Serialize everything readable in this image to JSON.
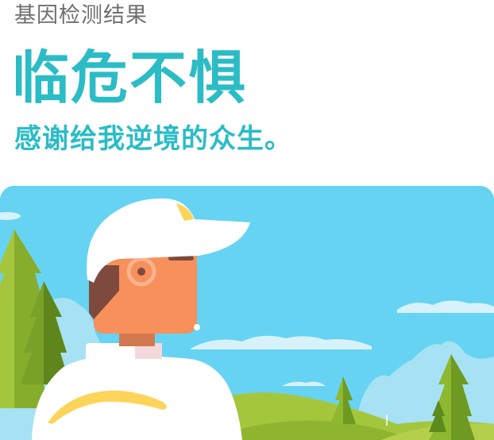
{
  "header": {
    "kicker": "基因检测结果",
    "headline": "临危不惧",
    "subline": "感谢给我逆境的众生。"
  },
  "illustration": {
    "description_icon": "golfer-illustration",
    "colors": {
      "sky": "#66d3f3",
      "headline": "#2bbcc6",
      "kicker": "#6e6e6e",
      "skin": "#f7905a",
      "hair": "#7f4a3e",
      "cap": "#ffffff",
      "grass": "#9fc43a",
      "tree": "#8db830"
    }
  }
}
